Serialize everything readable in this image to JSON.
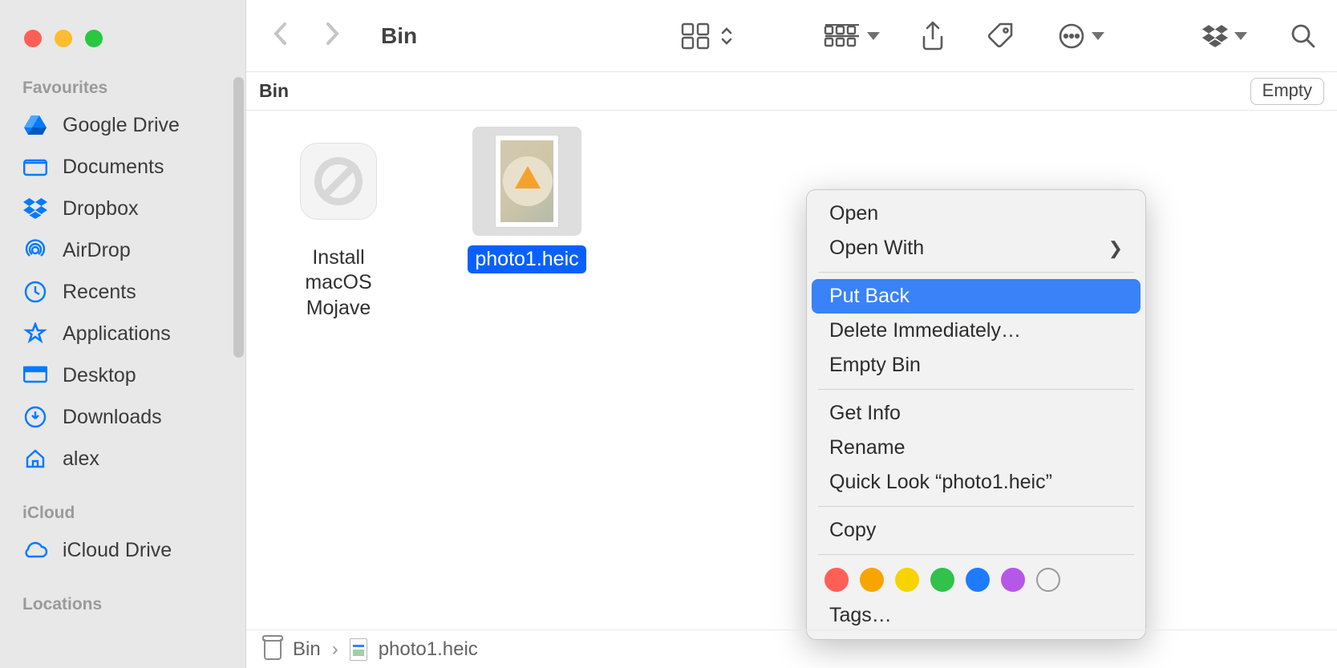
{
  "sidebar": {
    "sections": [
      {
        "title": "Favourites",
        "items": [
          {
            "label": "Google Drive",
            "icon": "gdrive"
          },
          {
            "label": "Documents",
            "icon": "folder"
          },
          {
            "label": "Dropbox",
            "icon": "dropbox"
          },
          {
            "label": "AirDrop",
            "icon": "airdrop"
          },
          {
            "label": "Recents",
            "icon": "recents"
          },
          {
            "label": "Applications",
            "icon": "apps"
          },
          {
            "label": "Desktop",
            "icon": "desktop"
          },
          {
            "label": "Downloads",
            "icon": "downloads"
          },
          {
            "label": "alex",
            "icon": "home"
          }
        ]
      },
      {
        "title": "iCloud",
        "items": [
          {
            "label": "iCloud Drive",
            "icon": "icloud"
          }
        ]
      },
      {
        "title": "Locations",
        "items": []
      }
    ]
  },
  "header": {
    "title": "Bin",
    "location": "Bin",
    "empty_button": "Empty"
  },
  "files": [
    {
      "name": "Install macOS Mojave",
      "type": "app",
      "selected": false
    },
    {
      "name": "photo1.heic",
      "type": "image",
      "selected": true
    }
  ],
  "context_menu": {
    "items": [
      {
        "label": "Open",
        "type": "item"
      },
      {
        "label": "Open With",
        "type": "submenu"
      },
      {
        "type": "separator"
      },
      {
        "label": "Put Back",
        "type": "item",
        "highlighted": true
      },
      {
        "label": "Delete Immediately…",
        "type": "item"
      },
      {
        "label": "Empty Bin",
        "type": "item"
      },
      {
        "type": "separator"
      },
      {
        "label": "Get Info",
        "type": "item"
      },
      {
        "label": "Rename",
        "type": "item"
      },
      {
        "label": "Quick Look “photo1.heic”",
        "type": "item"
      },
      {
        "type": "separator"
      },
      {
        "label": "Copy",
        "type": "item"
      },
      {
        "type": "separator"
      },
      {
        "type": "colors",
        "colors": [
          "#ff5f57",
          "#f7a500",
          "#f5d400",
          "#30c24b",
          "#1e7bff",
          "#b558e8",
          "none"
        ]
      },
      {
        "label": "Tags…",
        "type": "item"
      }
    ]
  },
  "pathbar": {
    "segments": [
      "Bin",
      "photo1.heic"
    ]
  },
  "colors": {
    "accent": "#007aff",
    "selection": "#0a60ff",
    "menu_highlight": "#3a82f7"
  }
}
